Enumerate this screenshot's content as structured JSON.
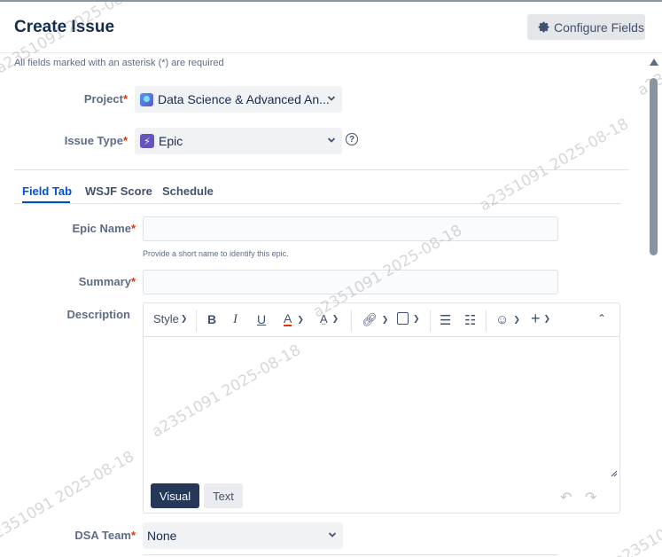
{
  "header": {
    "title": "Create Issue",
    "configure_fields_label": "Configure Fields"
  },
  "required_note": "All fields marked with an asterisk (*) are required",
  "project": {
    "label": "Project",
    "required_marker": "*",
    "value": "Data Science & Advanced An..."
  },
  "issue_type": {
    "label": "Issue Type",
    "required_marker": "*",
    "value": "Epic"
  },
  "tabs": [
    {
      "label": "Field Tab",
      "active": true
    },
    {
      "label": "WSJF Score",
      "active": false
    },
    {
      "label": "Schedule",
      "active": false
    }
  ],
  "epic_name": {
    "label": "Epic Name",
    "required_marker": "*",
    "value": "",
    "helper": "Provide a short name to identify this epic."
  },
  "summary": {
    "label": "Summary",
    "required_marker": "*",
    "value": ""
  },
  "description": {
    "label": "Description",
    "toolbar": {
      "style_label": "Style",
      "bold": "B",
      "italic": "I",
      "underline": "U",
      "text_color": "A"
    },
    "mode_visual": "Visual",
    "mode_text": "Text"
  },
  "dsa_team": {
    "label": "DSA Team",
    "required_marker": "*",
    "value": "None"
  },
  "watermark_text": "a2351091 2025-08-18",
  "colors": {
    "accent": "#0052cc",
    "required": "#de350b",
    "epic": "#6554c0",
    "visual_button": "#253858"
  }
}
